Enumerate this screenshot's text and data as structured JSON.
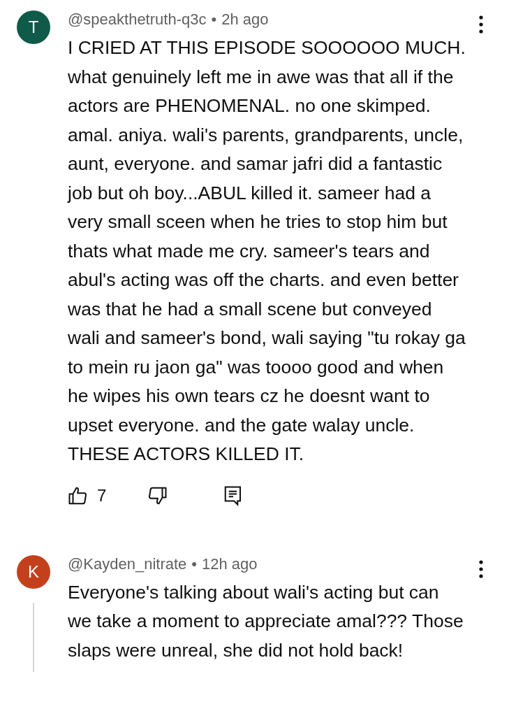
{
  "comments": [
    {
      "avatar_letter": "T",
      "color": "#0f5a48",
      "author": "@speakthetruth-q3c",
      "separator": "•",
      "time": "2h ago",
      "text": "I CRIED AT THIS EPISODE SOOOOOO MUCH. what genuinely left me in awe was that all if the actors are PHENOMENAL. no one skimped. amal. aniya. wali's parents, grandparents, uncle, aunt, everyone. and samar jafri did a fantastic job but oh boy...ABUL killed it. sameer had a very small sceen when he tries to stop him but thats what made me cry. sameer's tears and abul's acting was off the charts. and even better was that he had a small scene but conveyed wali and sameer's bond, wali saying \"tu rokay ga to mein ru jaon ga\" was toooo good and when he wipes his own tears cz he doesnt want to upset everyone. and the gate walay uncle. THESE ACTORS KILLED IT.",
      "likes": "7",
      "thread_line": false
    },
    {
      "avatar_letter": "K",
      "color": "#c4401c",
      "author": "@Kayden_nitrate",
      "separator": "•",
      "time": "12h ago",
      "text": "Everyone's talking about wali's acting but can we take a moment to appreciate amal??? Those slaps were unreal, she did not hold back!",
      "thread_line": true
    }
  ]
}
